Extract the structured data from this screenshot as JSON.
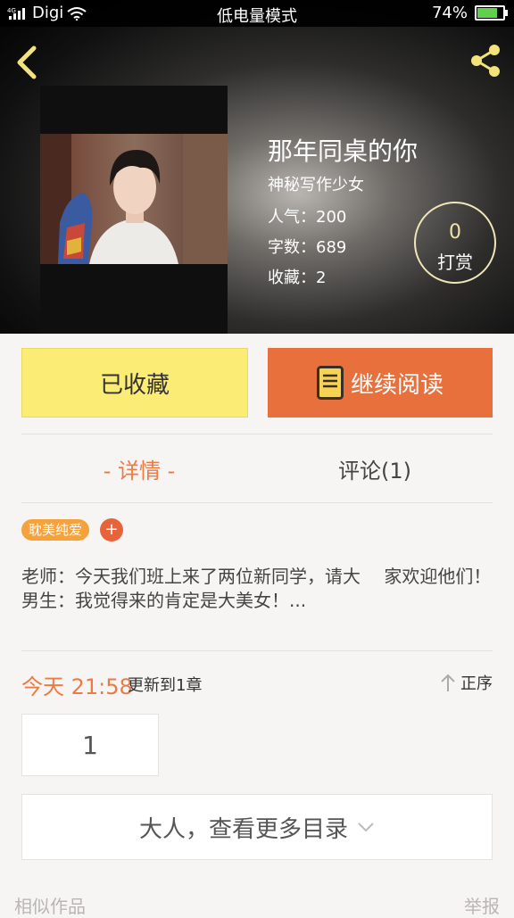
{
  "status_bar": {
    "carrier": "Digi",
    "center_text": "低电量模式",
    "battery_percent": "74%",
    "battery_level": 0.74
  },
  "header": {
    "back_icon": "chevron-left-icon",
    "share_icon": "share-icon"
  },
  "book": {
    "title": "那年同桌的你",
    "author": "神秘写作少女",
    "popularity": "人气：200",
    "word_count": "字数：689",
    "favorites": "收藏：2",
    "reward_count": "0",
    "reward_label": "打赏"
  },
  "actions": {
    "favorited_label": "已收藏",
    "continue_label": "继续阅读",
    "book_icon": "book-icon"
  },
  "tabs": {
    "detail": "- 详情 -",
    "comments": "评论(1)"
  },
  "tags": [
    "耽美纯爱"
  ],
  "synopsis": {
    "line1": "老师：今天我们班上来了两位新同学，请大　 家欢迎他们！",
    "line2": "男生：我觉得来的肯定是大美女！..."
  },
  "update": {
    "time": "今天 21:58",
    "text": "更新到1章",
    "sort_label": "正序"
  },
  "chapters": {
    "page": "1",
    "more_label": "大人，查看更多目录"
  },
  "footer": {
    "similar": "相似作品",
    "report": "举报"
  },
  "colors": {
    "accent_orange": "#e8703c",
    "fav_yellow": "#fbec75",
    "battery_green": "#5fd14a"
  }
}
